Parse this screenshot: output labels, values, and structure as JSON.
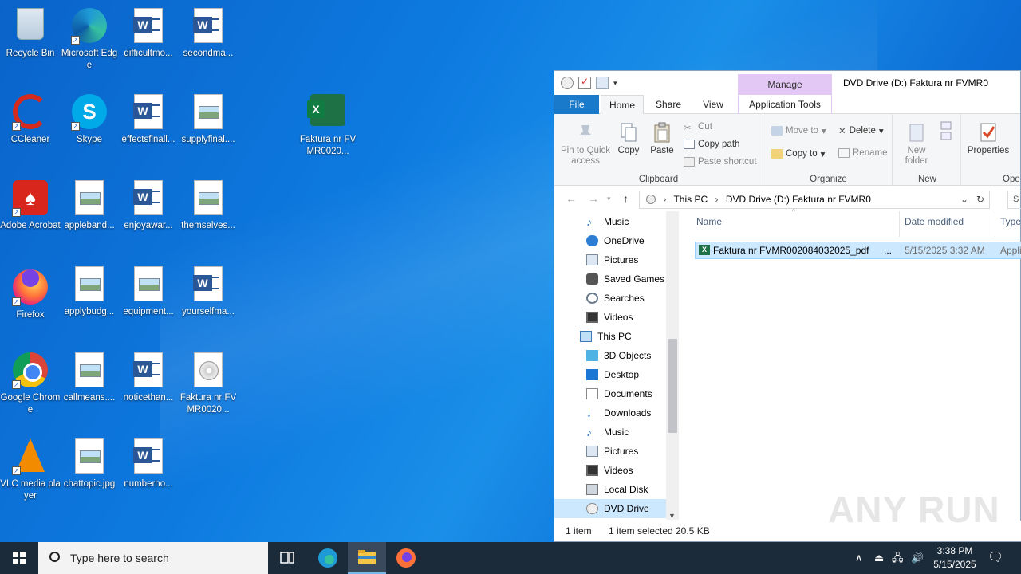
{
  "desktop": {
    "icons": [
      {
        "label": "Recycle Bin"
      },
      {
        "label": "Microsoft Edge"
      },
      {
        "label": "difficultmo..."
      },
      {
        "label": "secondma..."
      },
      {
        "label": "CCleaner"
      },
      {
        "label": "Skype"
      },
      {
        "label": "effectsfinall..."
      },
      {
        "label": "supplyfinal...."
      },
      {
        "label": "Faktura nr FVMR0020..."
      },
      {
        "label": "Adobe Acrobat"
      },
      {
        "label": "appleband..."
      },
      {
        "label": "enjoyawar..."
      },
      {
        "label": "themselves..."
      },
      {
        "label": "Firefox"
      },
      {
        "label": "applybudg..."
      },
      {
        "label": "equipment..."
      },
      {
        "label": "yourselfma..."
      },
      {
        "label": "Google Chrome"
      },
      {
        "label": "callmeans...."
      },
      {
        "label": "noticethan..."
      },
      {
        "label": "Faktura nr FVMR0020..."
      },
      {
        "label": "VLC media player"
      },
      {
        "label": "chattopic.jpg"
      },
      {
        "label": "numberho..."
      }
    ]
  },
  "explorer": {
    "title": "DVD Drive (D:) Faktura nr FVMR0",
    "context_tab": "Manage",
    "tabs": {
      "file": "File",
      "home": "Home",
      "share": "Share",
      "view": "View",
      "app_tools": "Application Tools"
    },
    "ribbon": {
      "pin": "Pin to Quick access",
      "copy": "Copy",
      "paste": "Paste",
      "cut": "Cut",
      "copy_path": "Copy path",
      "paste_shortcut": "Paste shortcut",
      "clipboard": "Clipboard",
      "move_to": "Move to",
      "copy_to": "Copy to",
      "delete": "Delete",
      "rename": "Rename",
      "organize": "Organize",
      "new_folder": "New folder",
      "new": "New",
      "properties": "Properties",
      "open": "Ope"
    },
    "address": {
      "root": "This PC",
      "current": "DVD Drive (D:) Faktura nr FVMR0"
    },
    "search_placeholder": "S",
    "nav_items": [
      {
        "label": "Music",
        "icon": "music-icon"
      },
      {
        "label": "OneDrive",
        "icon": "cloud-icon"
      },
      {
        "label": "Pictures",
        "icon": "pictures-icon"
      },
      {
        "label": "Saved Games",
        "icon": "games-icon"
      },
      {
        "label": "Searches",
        "icon": "search-icon"
      },
      {
        "label": "Videos",
        "icon": "videos-icon"
      },
      {
        "label": "This PC",
        "icon": "computer-icon"
      },
      {
        "label": "3D Objects",
        "icon": "cube-icon"
      },
      {
        "label": "Desktop",
        "icon": "desktop-icon"
      },
      {
        "label": "Documents",
        "icon": "documents-icon"
      },
      {
        "label": "Downloads",
        "icon": "download-icon"
      },
      {
        "label": "Music",
        "icon": "music-icon"
      },
      {
        "label": "Pictures",
        "icon": "pictures-icon"
      },
      {
        "label": "Videos",
        "icon": "videos-icon"
      },
      {
        "label": "Local Disk (C:)",
        "icon": "disk-icon"
      },
      {
        "label": "DVD Drive (D:)",
        "icon": "dvd-icon"
      }
    ],
    "columns": {
      "name": "Name",
      "date": "Date modified",
      "type": "Type"
    },
    "file": {
      "name": "Faktura nr FVMR002084032025_pdf",
      "ellipsis": "...",
      "date": "5/15/2025 3:32 AM",
      "type": "Appli"
    },
    "status": {
      "count": "1 item",
      "selected": "1 item selected",
      "size": "20.5 KB"
    }
  },
  "watermark": "ANY RUN",
  "taskbar": {
    "search_placeholder": "Type here to search",
    "time": "3:38 PM",
    "date": "5/15/2025"
  },
  "colors": {
    "accent": "#1979ca",
    "selection": "#cce8ff",
    "taskbar": "#1c2b3a",
    "manage": "#e3c8f5"
  }
}
